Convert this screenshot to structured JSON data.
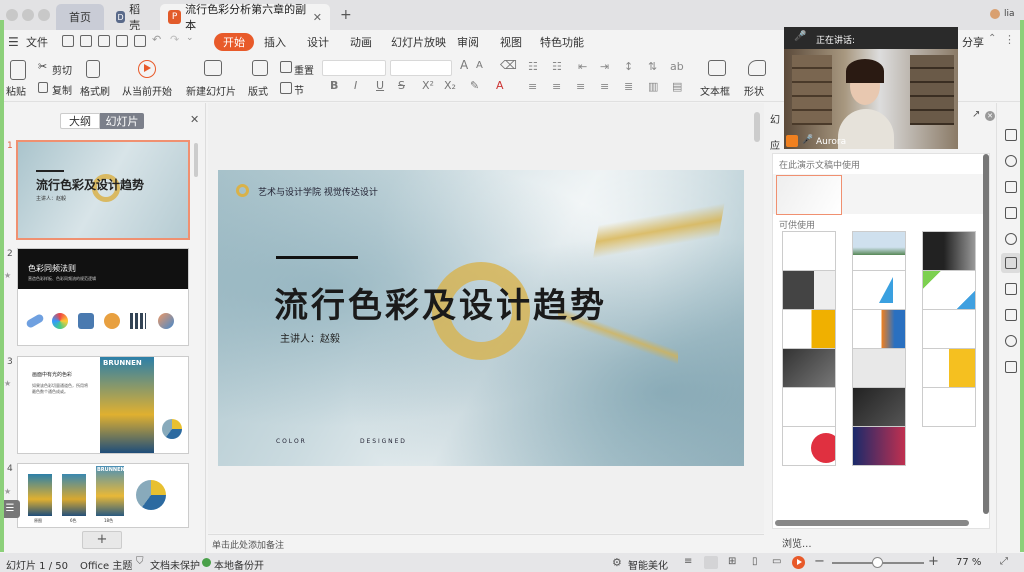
{
  "window": {
    "tabs": [
      {
        "label": "首页"
      },
      {
        "label": "稻壳"
      },
      {
        "label": "流行色彩分析第六章的副本"
      }
    ],
    "user_initial": "lia"
  },
  "menu": {
    "file": "文件",
    "items": [
      "开始",
      "插入",
      "设计",
      "动画",
      "幻灯片放映",
      "审阅",
      "视图",
      "特色功能"
    ],
    "share": "分享"
  },
  "ribbon": {
    "paste": "粘贴",
    "cut": "剪切",
    "copy": "复制",
    "format_painter": "格式刷",
    "play_from_current": "从当前开始",
    "new_slide": "新建幻灯片",
    "layout": "版式",
    "section": "节",
    "reset": "重置",
    "textbox": "文本框",
    "shape": "形状"
  },
  "left_panel": {
    "tab_outline": "大纲",
    "tab_slides": "幻灯片",
    "slides": [
      {
        "num": "1",
        "title": "流行色彩及设计趋势",
        "sub": "主讲人：赵毅"
      },
      {
        "num": "2",
        "title": "色彩同频法则",
        "sub": "营造色彩样板、色彩同频流的规范逻辑"
      },
      {
        "num": "3",
        "title": "画面中有光的色彩",
        "sub": "如果该色彩切量通道色，所用将最色数个通色成或。",
        "poster": "BRUNNEN"
      },
      {
        "num": "4",
        "captions": [
          "原图",
          "6色",
          "18色"
        ],
        "poster": "BRUNNEN"
      }
    ],
    "add": "+"
  },
  "slide": {
    "org": "艺术与设计学院  视觉传达设计",
    "title": "流行色彩及设计趋势",
    "presenter": "主讲人：赵毅",
    "footer_left": "C O L O R",
    "footer_right": "D E S I G N E D"
  },
  "notes_placeholder": "单击此处添加备注",
  "right_panel": {
    "title_partial": "幻",
    "apply_partial": "应",
    "in_use_label": "在此演示文稿中使用",
    "available_label": "可供使用",
    "browse": "浏览..."
  },
  "video": {
    "speaking_label": "正在讲话:",
    "name": "Aurora"
  },
  "status": {
    "slide_pos": "幻灯片 1 / 50",
    "theme": "Office 主题",
    "protect": "文档未保护",
    "backup": "本地备份开",
    "beautify": "智能美化",
    "zoom": "77 %",
    "zoom_level": 0.49
  },
  "colors": {
    "accent": "#e85a2a",
    "gold": "#d9b24a"
  }
}
